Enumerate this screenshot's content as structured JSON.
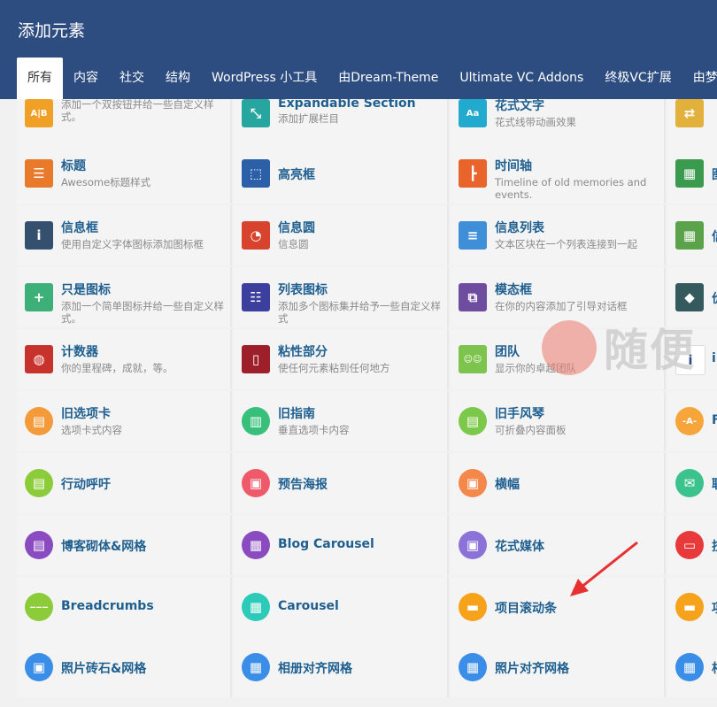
{
  "header": {
    "title": "添加元素",
    "tabs": [
      "所有",
      "内容",
      "社交",
      "结构",
      "WordPress 小工具",
      "由Dream-Theme",
      "Ultimate VC Addons",
      "终极VC扩展",
      "由梦"
    ]
  },
  "watermark_text": "随便",
  "rows": [
    [
      {
        "name": "",
        "desc": "添加一个双按钮并给一些自定义样式。",
        "icon": "double-button-icon",
        "color": "#f0a024"
      },
      {
        "name": "Expandable Section",
        "desc": "添加扩展栏目",
        "icon": "expand-arrows-icon",
        "color": "#27a6a0"
      },
      {
        "name": "花式文字",
        "desc": "花式线带动画效果",
        "icon": "fancy-text-icon",
        "color": "#22a9ce"
      },
      {
        "name": "",
        "desc": "",
        "icon": "switch-icon",
        "color": "#e2b13b"
      }
    ],
    [
      {
        "name": "标题",
        "desc": "Awesome标题样式",
        "icon": "heading-icon",
        "color": "#e9792b"
      },
      {
        "name": "高亮框",
        "desc": "",
        "icon": "highlight-box-icon",
        "color": "#2b5fa8"
      },
      {
        "name": "时间轴",
        "desc": "Timeline of old memories and events.",
        "icon": "timeline-icon",
        "color": "#e8642a"
      },
      {
        "name": "图",
        "desc": "",
        "icon": "grid-icon",
        "color": "#3a9b4f"
      }
    ],
    [
      {
        "name": "信息框",
        "desc": "使用自定义字体图标添加图标框",
        "icon": "info-box-icon",
        "color": "#35506e"
      },
      {
        "name": "信息圆",
        "desc": "信息圆",
        "icon": "info-circle-icon",
        "color": "#d8432e"
      },
      {
        "name": "信息列表",
        "desc": "文本区块在一个列表连接到一起",
        "icon": "info-list-icon",
        "color": "#3e8fd8"
      },
      {
        "name": "信",
        "desc": "",
        "icon": "table-icon",
        "color": "#5aa34a"
      }
    ],
    [
      {
        "name": "只是图标",
        "desc": "添加一个简单图标并给一些自定义样式。",
        "icon": "plus-icon",
        "color": "#3cb078"
      },
      {
        "name": "列表图标",
        "desc": "添加多个图标集并给予一些自定义样式",
        "icon": "list-icon",
        "color": "#3c3f9e"
      },
      {
        "name": "模态框",
        "desc": "在你的内容添加了引导对话框",
        "icon": "modal-icon",
        "color": "#6e4da0"
      },
      {
        "name": "价",
        "desc": "",
        "icon": "tag-icon",
        "color": "#345a5e"
      }
    ],
    [
      {
        "name": "计数器",
        "desc": "你的里程碑，成就，等。",
        "icon": "counter-icon",
        "color": "#c8322c"
      },
      {
        "name": "粘性部分",
        "desc": "使任何元素粘到任何地方",
        "icon": "sticky-icon",
        "color": "#9c1f2a"
      },
      {
        "name": "团队",
        "desc": "显示你的卓越团队",
        "icon": "team-icon",
        "color": "#7cc44e"
      },
      {
        "name": "i",
        "desc": "",
        "icon": "info-icon",
        "color": "#ffffff"
      }
    ],
    [
      {
        "name": "旧选项卡",
        "desc": "选项卡式内容",
        "icon": "tabs-icon",
        "color": "#f39a3a"
      },
      {
        "name": "旧指南",
        "desc": "垂直选项卡内容",
        "icon": "tour-icon",
        "color": "#38c07a"
      },
      {
        "name": "旧手风琴",
        "desc": "可折叠内容面板",
        "icon": "accordion-icon",
        "color": "#7cc84a"
      },
      {
        "name": "F",
        "desc": "",
        "icon": "font-icon",
        "color": "#f6a53a"
      }
    ],
    [
      {
        "name": "行动呼吁",
        "desc": "",
        "icon": "call-to-action-icon",
        "color": "#8ccc3a"
      },
      {
        "name": "预告海报",
        "desc": "",
        "icon": "poster-icon",
        "color": "#ee5a6a"
      },
      {
        "name": "横幅",
        "desc": "",
        "icon": "banner-icon",
        "color": "#f4884a"
      },
      {
        "name": "联",
        "desc": "",
        "icon": "mail-icon",
        "color": "#3cc28c"
      }
    ],
    [
      {
        "name": "博客砌体&网格",
        "desc": "",
        "icon": "blog-masonry-icon",
        "color": "#8a4ac0"
      },
      {
        "name": "Blog Carousel",
        "desc": "",
        "icon": "blog-carousel-icon",
        "color": "#8a4ac0"
      },
      {
        "name": "花式媒体",
        "desc": "",
        "icon": "fancy-media-icon",
        "color": "#8a72d8"
      },
      {
        "name": "技",
        "desc": "",
        "icon": "button-icon",
        "color": "#e83a3a"
      }
    ],
    [
      {
        "name": "Breadcrumbs",
        "desc": "",
        "icon": "breadcrumbs-icon",
        "color": "#8ccc3a"
      },
      {
        "name": "Carousel",
        "desc": "",
        "icon": "carousel-icon",
        "color": "#2ccab8"
      },
      {
        "name": "项目滚动条",
        "desc": "",
        "icon": "portfolio-scroller-icon",
        "color": "#f6a21a"
      },
      {
        "name": "项",
        "desc": "",
        "icon": "portfolio-icon",
        "color": "#f6a21a"
      }
    ],
    [
      {
        "name": "照片砖石&网格",
        "desc": "",
        "icon": "photo-masonry-icon",
        "color": "#3a8ee8"
      },
      {
        "name": "相册对齐网格",
        "desc": "",
        "icon": "gallery-justified-icon",
        "color": "#3a8ee8"
      },
      {
        "name": "照片对齐网格",
        "desc": "",
        "icon": "photo-justified-icon",
        "color": "#3a8ee8"
      },
      {
        "name": "相",
        "desc": "",
        "icon": "gallery-icon",
        "color": "#3a8ee8"
      }
    ]
  ]
}
